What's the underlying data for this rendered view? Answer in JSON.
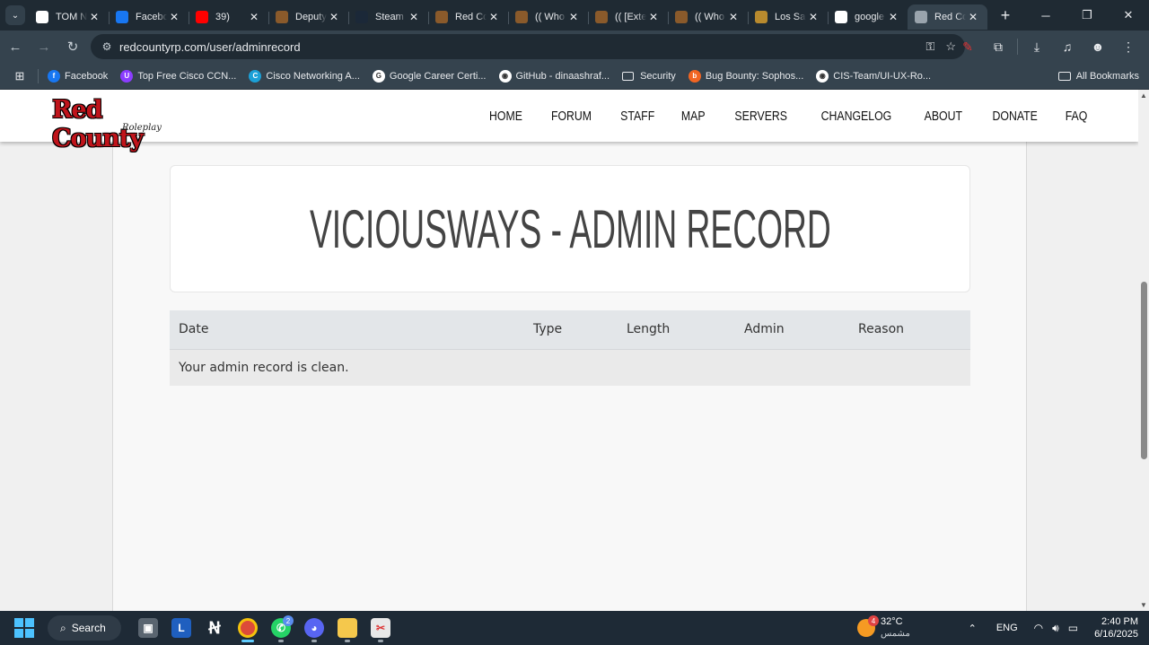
{
  "browser": {
    "tabs": [
      {
        "title": "TOM N",
        "icon": "notion-icon",
        "color": "#ffffff"
      },
      {
        "title": "Facebo",
        "icon": "facebook-icon",
        "color": "#1877f2"
      },
      {
        "title": "39)",
        "icon": "youtube-icon",
        "color": "#ff0000"
      },
      {
        "title": "Deputy",
        "icon": "redcounty-icon",
        "color": "#8a5a2b"
      },
      {
        "title": "Steam",
        "icon": "steam-icon",
        "color": "#1b2838"
      },
      {
        "title": "Red Co",
        "icon": "redcounty-icon",
        "color": "#8a5a2b"
      },
      {
        "title": "(( Who",
        "icon": "redcounty-icon",
        "color": "#8a5a2b"
      },
      {
        "title": "(( [Exte",
        "icon": "redcounty-icon",
        "color": "#8a5a2b"
      },
      {
        "title": "(( Who",
        "icon": "redcounty-icon",
        "color": "#8a5a2b"
      },
      {
        "title": "Los Sa",
        "icon": "lspd-icon",
        "color": "#b88a2e"
      },
      {
        "title": "google",
        "icon": "google-icon",
        "color": "#ffffff"
      },
      {
        "title": "Red Co",
        "icon": "globe-icon",
        "color": "#9aa4ad",
        "active": true
      }
    ],
    "url": "redcountyrp.com/user/adminrecord",
    "bookmarks": [
      {
        "label": "Facebook",
        "icon": "facebook-icon",
        "color": "#1877f2",
        "glyph": "f"
      },
      {
        "label": "Top Free Cisco CCN...",
        "icon": "udemy-icon",
        "color": "#8b3dff",
        "glyph": "U"
      },
      {
        "label": "Cisco Networking A...",
        "icon": "cisco-icon",
        "color": "#1ba0d7",
        "glyph": "C"
      },
      {
        "label": "Google Career Certi...",
        "icon": "google-icon",
        "color": "#ffffff",
        "glyph": "G"
      },
      {
        "label": "GitHub - dinaashraf...",
        "icon": "github-icon",
        "color": "#ffffff",
        "glyph": "◉"
      },
      {
        "label": "Security",
        "icon": "folder-icon",
        "color": "",
        "glyph": ""
      },
      {
        "label": "Bug Bounty: Sophos...",
        "icon": "bugcrowd-icon",
        "color": "#f26522",
        "glyph": "b"
      },
      {
        "label": "CIS-Team/UI-UX-Ro...",
        "icon": "github-icon",
        "color": "#ffffff",
        "glyph": "◉"
      }
    ],
    "all_bookmarks": "All Bookmarks"
  },
  "site": {
    "logo_text": "Red County",
    "logo_sub": "Roleplay",
    "menu": [
      "HOME",
      "FORUM",
      "STAFF",
      "MAP",
      "SERVERS",
      "CHANGELOG",
      "ABOUT",
      "DONATE",
      "FAQ"
    ]
  },
  "page": {
    "title": "VICIOUSWAYS - ADMIN RECORD",
    "table": {
      "columns": [
        "Date",
        "Type",
        "Length",
        "Admin",
        "Reason"
      ],
      "empty_message": "Your admin record is clean."
    }
  },
  "taskbar": {
    "search_label": "Search",
    "weather": {
      "temp": "32°C",
      "condition": "مشمس",
      "badge": "4"
    },
    "language": "ENG",
    "time": "2:40 PM",
    "date": "6/16/2025",
    "whatsapp_badge": "2"
  }
}
